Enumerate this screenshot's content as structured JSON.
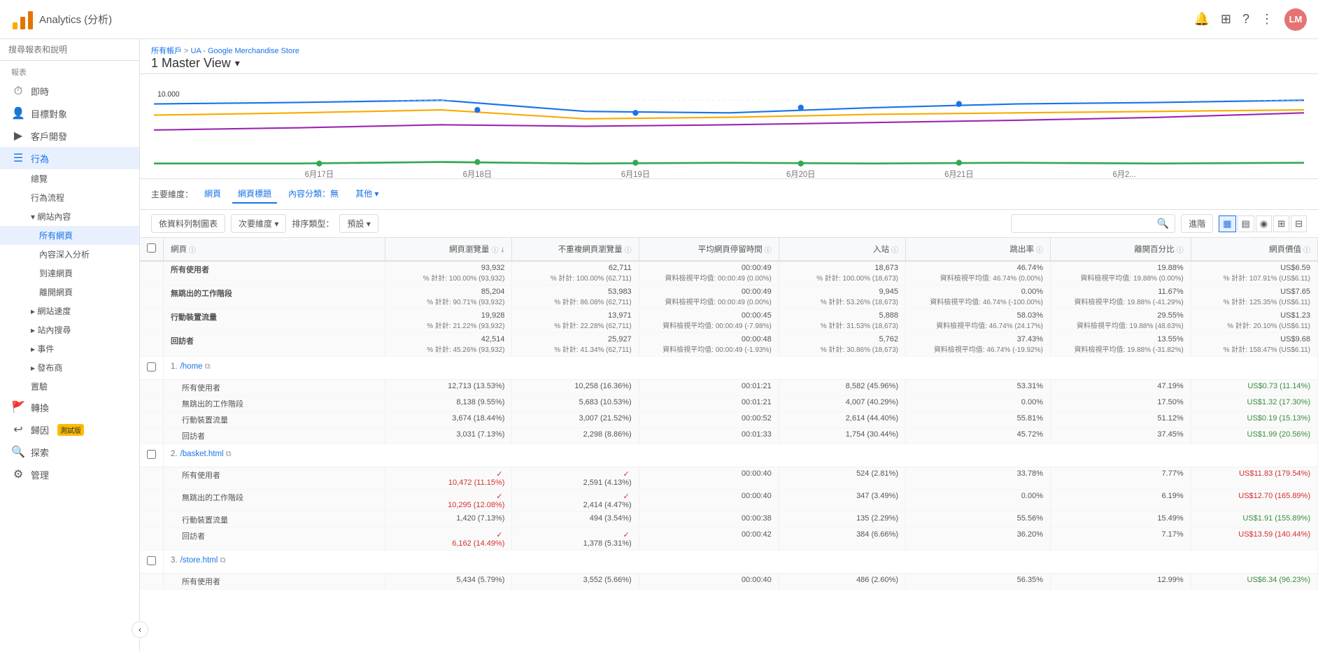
{
  "app": {
    "title": "Analytics (分析)",
    "logo_text": "Analytics (分析)"
  },
  "breadcrumb": {
    "part1": "所有帳戶",
    "separator": " > ",
    "part2": "UA - Google Merchandise Store"
  },
  "page_title": "1 Master View",
  "top_nav": {
    "bell_icon": "🔔",
    "grid_icon": "⊞",
    "help_icon": "?",
    "more_icon": "⋮",
    "user_initials": "LM"
  },
  "sidebar": {
    "search_placeholder": "搜尋報表和說明",
    "sections": [
      {
        "label": "報表",
        "items": [
          {
            "id": "realtime",
            "label": "即時",
            "icon": "⏱",
            "has_sub": false
          },
          {
            "id": "audience",
            "label": "目標對象",
            "icon": "👤",
            "has_sub": false
          },
          {
            "id": "acquisition",
            "label": "客戶開發",
            "icon": "▶",
            "has_sub": false
          },
          {
            "id": "behavior",
            "label": "行為",
            "icon": "☰",
            "active": true,
            "has_sub": true,
            "subitems": [
              {
                "id": "overview",
                "label": "總覽"
              },
              {
                "id": "flow",
                "label": "行為流程"
              },
              {
                "id": "site-content",
                "label": "網站內容",
                "active": true,
                "expanded": true,
                "subitems": [
                  {
                    "id": "all-pages",
                    "label": "所有網頁",
                    "active": true
                  },
                  {
                    "id": "content-drilldown",
                    "label": "內容深入分析"
                  },
                  {
                    "id": "landing-pages",
                    "label": "到達網頁"
                  },
                  {
                    "id": "exit-pages",
                    "label": "離開網頁"
                  }
                ]
              },
              {
                "id": "site-speed",
                "label": "網站速度",
                "collapsed": true
              },
              {
                "id": "site-search",
                "label": "站內搜尋",
                "collapsed": true
              },
              {
                "id": "events",
                "label": "事件",
                "collapsed": true
              },
              {
                "id": "publisher",
                "label": "發布商",
                "collapsed": true
              },
              {
                "id": "experiments",
                "label": "置驗"
              }
            ]
          },
          {
            "id": "conversions",
            "label": "轉換",
            "icon": "🚩",
            "has_sub": false
          },
          {
            "id": "attribution",
            "label": "歸因",
            "icon": "↩",
            "beta": true,
            "has_sub": false
          },
          {
            "id": "explore",
            "label": "探索",
            "icon": "🔍",
            "has_sub": false
          },
          {
            "id": "admin",
            "label": "管理",
            "icon": "⚙",
            "has_sub": false
          }
        ]
      }
    ],
    "collapse_icon": "‹"
  },
  "dimension_bar": {
    "label": "主要維度：",
    "tabs": [
      {
        "id": "page",
        "label": "網頁",
        "active": false
      },
      {
        "id": "page-title",
        "label": "網頁標題",
        "active": true
      },
      {
        "id": "content-group",
        "label": "內容分類：無",
        "active": false
      },
      {
        "id": "other",
        "label": "其他",
        "active": false
      }
    ]
  },
  "toolbar": {
    "col_btn": "依資料列制圖表",
    "dimension_btn": "次要維度",
    "sort_btn": "排序類型：",
    "default_btn": "預設",
    "advance_btn": "進階",
    "view_icons": [
      "grid",
      "bar",
      "pie",
      "table2",
      "custom"
    ]
  },
  "table": {
    "columns": [
      {
        "id": "checkbox",
        "label": ""
      },
      {
        "id": "page",
        "label": "網頁",
        "info": true
      },
      {
        "id": "pageviews",
        "label": "網頁瀏覽量",
        "info": true,
        "sort": "desc"
      },
      {
        "id": "unique-pageviews",
        "label": "不重複網頁瀏覽量",
        "info": true
      },
      {
        "id": "avg-time",
        "label": "平均網頁停留時間",
        "info": true
      },
      {
        "id": "entrances",
        "label": "入站",
        "info": true
      },
      {
        "id": "bounce-rate",
        "label": "跳出率",
        "info": true
      },
      {
        "id": "exit-rate",
        "label": "離開百分比",
        "info": true
      },
      {
        "id": "page-value",
        "label": "網頁價值",
        "info": true
      }
    ],
    "summary_rows": [
      {
        "label": "所有使用者",
        "pageviews": "93,932",
        "pageviews_pct": "% 計計: 100.00% (93,932)",
        "unique_pv": "62,711",
        "unique_pv_pct": "% 計計: 100.00% (62,711)",
        "avg_time": "00:00:49",
        "avg_time_note": "資料檢視平均值: 00:00:49 (0.00%)",
        "entrances": "18,673",
        "entrances_pct": "% 計計: 100.00% (18,673)",
        "bounce_rate": "46.74%",
        "bounce_note": "資料檢視平均值: 46.74% (0.00%)",
        "exit_rate": "19.88%",
        "exit_note": "資料檢視平均值: 19.88% (0.00%)",
        "page_value": "US$6.59",
        "page_value_pct": "% 計計: 107.91% (US$6.11)"
      },
      {
        "label": "無跳出的工作階段",
        "pageviews": "85,204",
        "pageviews_pct": "% 計計: 90.71% (93,932)",
        "unique_pv": "53,983",
        "unique_pv_pct": "% 計計: 86.08% (62,711)",
        "avg_time": "00:00:49",
        "avg_time_note": "資料檢視平均值: 00:00:49 (0.00%)",
        "entrances": "9,945",
        "entrances_pct": "% 計計: 53.26% (18,673)",
        "bounce_rate": "0.00%",
        "bounce_note": "資料檢視平均值: 46.74% (-100.00%)",
        "exit_rate": "11.67%",
        "exit_note": "資料檢視平均值: 19.88% (-41.29%)",
        "page_value": "US$7.65",
        "page_value_pct": "% 計計: 125.35% (US$6.11)"
      },
      {
        "label": "行動裝置流量",
        "pageviews": "19,928",
        "pageviews_pct": "% 計計: 21.22% (93,932)",
        "unique_pv": "13,971",
        "unique_pv_pct": "% 計計: 22.28% (62,711)",
        "avg_time": "00:00:45",
        "avg_time_note": "資料檢視平均值: 00:00:49 (-7.98%)",
        "entrances": "5,888",
        "entrances_pct": "% 計計: 31.53% (18,673)",
        "bounce_rate": "58.03%",
        "bounce_note": "資料檢視平均值: 46.74% (24.17%)",
        "exit_rate": "29.55%",
        "exit_note": "資料檢視平均值: 19.88% (48.63%)",
        "page_value": "US$1.23",
        "page_value_pct": "% 計計: 20.10% (US$6.11)"
      },
      {
        "label": "回訪者",
        "pageviews": "42,514",
        "pageviews_pct": "% 計計: 45.26% (93,932)",
        "unique_pv": "25,927",
        "unique_pv_pct": "% 計計: 41.34% (62,711)",
        "avg_time": "00:00:48",
        "avg_time_note": "資料檢視平均值: 00:00:49 (-1.93%)",
        "entrances": "5,762",
        "entrances_pct": "% 計計: 30.86% (18,673)",
        "bounce_rate": "37.43%",
        "bounce_note": "資料檢視平均值: 46.74% (-19.92%)",
        "exit_rate": "13.55%",
        "exit_note": "資料檢視平均值: 19.88% (-31.82%)",
        "page_value": "US$9.68",
        "page_value_pct": "% 計計: 158.47% (US$6.11)"
      }
    ],
    "data_rows": [
      {
        "num": "1.",
        "page": "/home",
        "segments": [
          {
            "label": "所有使用者",
            "pageviews": "12,713 (13.53%)",
            "unique_pv": "10,258 (16.36%)",
            "avg_time": "00:01:21",
            "entrances": "8,582 (45.96%)",
            "bounce_rate": "53.31%",
            "exit_rate": "47.19%",
            "page_value": "US$0.73 (11.14%)"
          },
          {
            "label": "無跳出的工作階段",
            "pageviews": "8,138 (9.55%)",
            "unique_pv": "5,683 (10.53%)",
            "avg_time": "00:01:21",
            "entrances": "4,007 (40.29%)",
            "bounce_rate": "0.00%",
            "exit_rate": "17.50%",
            "page_value": "US$1.32 (17.30%)"
          },
          {
            "label": "行動裝置流量",
            "pageviews": "3,674 (18.44%)",
            "unique_pv": "3,007 (21.52%)",
            "avg_time": "00:00:52",
            "entrances": "2,614 (44.40%)",
            "bounce_rate": "55.81%",
            "exit_rate": "51.12%",
            "page_value": "US$0.19 (15.13%)"
          },
          {
            "label": "回訪者",
            "pageviews": "3,031 (7.13%)",
            "unique_pv": "2,298 (8.86%)",
            "avg_time": "00:01:33",
            "entrances": "1,754 (30.44%)",
            "bounce_rate": "45.72%",
            "exit_rate": "37.45%",
            "page_value": "US$1.99 (20.56%)"
          }
        ]
      },
      {
        "num": "2.",
        "page": "/basket.html",
        "segments": [
          {
            "label": "所有使用者",
            "pageviews": "10,472 (11.15%)",
            "unique_pv": "2,591 (4.13%)",
            "avg_time": "00:00:40",
            "entrances": "524 (2.81%)",
            "bounce_rate": "33.78%",
            "exit_rate": "7.77%",
            "page_value": "US$11.83 (179.54%)",
            "flag": "down"
          },
          {
            "label": "無跳出的工作階段",
            "pageviews": "10,295 (12.08%)",
            "unique_pv": "2,414 (4.47%)",
            "avg_time": "00:00:40",
            "entrances": "347 (3.49%)",
            "bounce_rate": "0.00%",
            "exit_rate": "6.19%",
            "page_value": "US$12.70 (165.89%)",
            "flag": "down"
          },
          {
            "label": "行動裝置流量",
            "pageviews": "1,420 (7.13%)",
            "unique_pv": "494 (3.54%)",
            "avg_time": "00:00:38",
            "entrances": "135 (2.29%)",
            "bounce_rate": "55.56%",
            "exit_rate": "15.49%",
            "page_value": "US$1.91 (155.89%)"
          },
          {
            "label": "回訪者",
            "pageviews": "6,162 (14.49%)",
            "unique_pv": "1,378 (5.31%)",
            "avg_time": "00:00:42",
            "entrances": "384 (6.66%)",
            "bounce_rate": "36.20%",
            "exit_rate": "7.17%",
            "page_value": "US$13.59 (140.44%)",
            "flag": "down"
          }
        ]
      },
      {
        "num": "3.",
        "page": "/store.html",
        "segments": [
          {
            "label": "所有使用者",
            "pageviews": "5,434 (5.79%)",
            "unique_pv": "3,552 (5.66%)",
            "avg_time": "00:00:40",
            "entrances": "486 (2.60%)",
            "bounce_rate": "56.35%",
            "exit_rate": "12.99%",
            "page_value": "US$6.34 (96.23%)"
          }
        ]
      }
    ]
  },
  "chart": {
    "dates": [
      "6月17日",
      "6月18日",
      "6月19日",
      "6月20日",
      "6月21日",
      "6月2..."
    ],
    "baseline": 10000
  }
}
